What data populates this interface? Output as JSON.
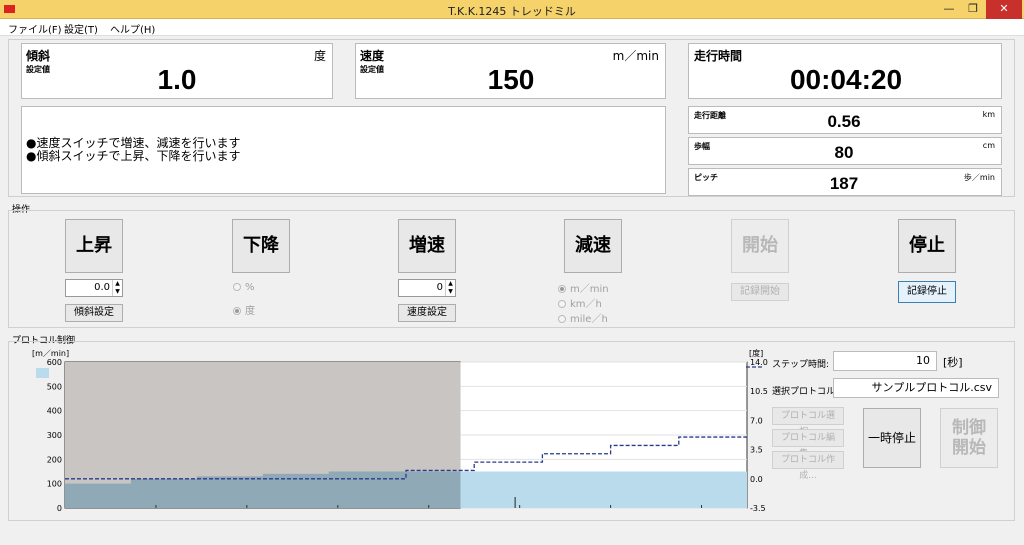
{
  "window": {
    "title": "T.K.K.1245 トレッドミル",
    "minimize": "—",
    "maximize": "❐",
    "close": "✕"
  },
  "menu": [
    "ファイル(F)",
    "設定(T)",
    "ヘルプ(H)"
  ],
  "incline": {
    "title": "傾斜",
    "sub": "設定値",
    "unit": "度",
    "value": "1.0"
  },
  "speed": {
    "title": "速度",
    "sub": "設定値",
    "unit": "m／min",
    "value": "150"
  },
  "run_time": {
    "title": "走行時間",
    "value": "00:04:20"
  },
  "distance": {
    "title": "走行距離",
    "unit": "km",
    "value": "0.56"
  },
  "stride": {
    "title": "歩幅",
    "unit": "cm",
    "value": "80"
  },
  "pitch": {
    "title": "ピッチ",
    "unit": "歩／min",
    "value": "187"
  },
  "messages": [
    "●速度スイッチで増速、減速を行います",
    "●傾斜スイッチで上昇、下降を行います"
  ],
  "operation": {
    "label": "操作",
    "up": "上昇",
    "down": "下降",
    "speed_up": "増速",
    "speed_down": "減速",
    "start": "開始",
    "stop": "停止",
    "incline_spin": "0.0",
    "incline_set": "傾斜設定",
    "speed_spin": "0",
    "speed_set": "速度設定",
    "record_start": "記録開始",
    "record_stop": "記録停止",
    "unit_percent": "%",
    "unit_degree": "度",
    "unit_mmin": "m／min",
    "unit_kmh": "km／h",
    "unit_mileh": "mile／h"
  },
  "protocol": {
    "label": "プロトコル制御",
    "step_time_label": "ステップ時間:",
    "step_time_value": "10",
    "step_time_unit": "[秒]",
    "selected_label": "選択プロトコル:",
    "selected_value": "サンプルプロトコル.csv",
    "select_btn": "プロトコル選択...",
    "edit_btn": "プロトコル編集...",
    "create_btn": "プロトコル作成...",
    "pause_btn": "一時停止",
    "control_start_line1": "制御",
    "control_start_line2": "開始"
  },
  "chart_data": {
    "type": "area",
    "left_axis_label": "[m／min]",
    "right_axis_label": "[度]",
    "left_ticks": [
      "0",
      "100",
      "200",
      "300",
      "400",
      "500",
      "600"
    ],
    "right_ticks": [
      "-3.5",
      "0.0",
      "3.5",
      "7.0",
      "10.5",
      "14.0"
    ],
    "ylim_left": [
      0,
      600
    ],
    "ylim_right": [
      -3.5,
      14.0
    ],
    "speed_steps": [
      100,
      120,
      130,
      140,
      150,
      150
    ],
    "incline_steps": [
      0.0,
      0.0,
      0.0,
      0.0,
      0.0,
      1.0,
      2.0,
      3.0,
      4.0,
      5.0
    ],
    "elapsed_fraction": 0.58,
    "colors": {
      "elapsed_bg": "#c9c5c3",
      "speed_fill_elapsed": "#8fa9b6",
      "speed_fill_future": "#b9dbec",
      "incline_line": "#2a3a8c"
    }
  }
}
